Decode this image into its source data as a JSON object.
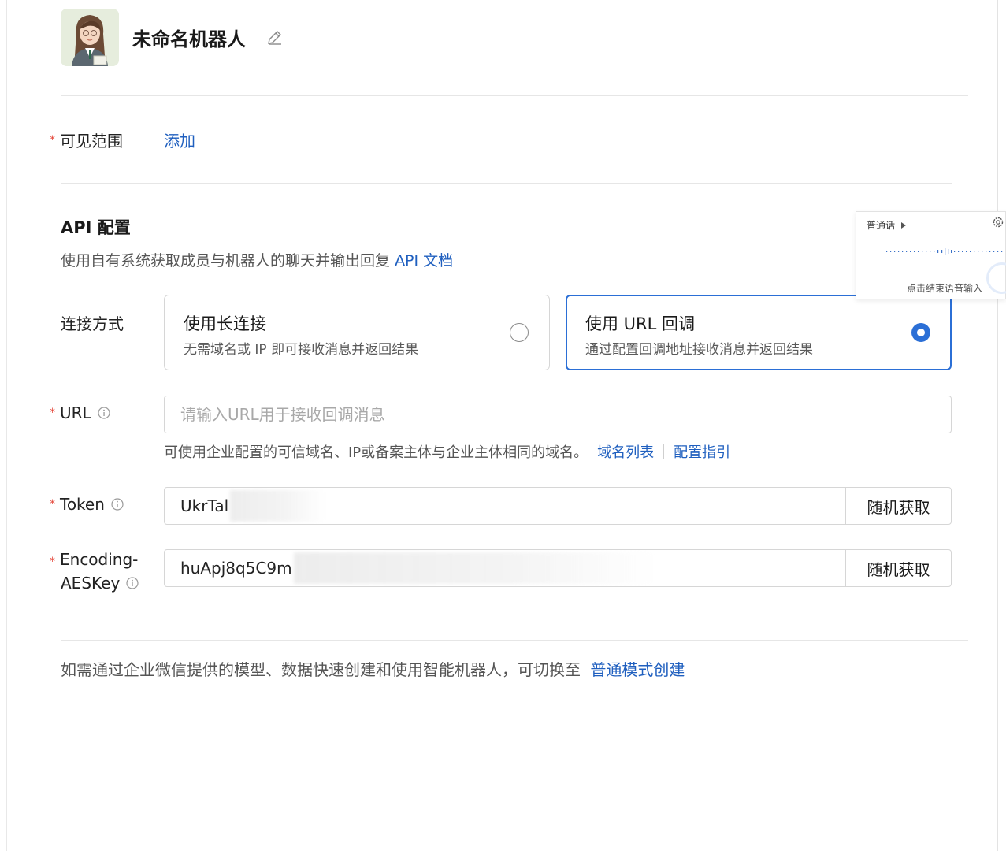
{
  "bot": {
    "name": "未命名机器人"
  },
  "visibility": {
    "label": "可见范围",
    "required_mark": "*",
    "add_link": "添加"
  },
  "api_section": {
    "title": "API 配置",
    "description": "使用自有系统获取成员与机器人的聊天并输出回复",
    "doc_link": "API 文档"
  },
  "connection": {
    "label": "连接方式",
    "options": [
      {
        "title": "使用长连接",
        "desc": "无需域名或 IP 即可接收消息并返回结果",
        "selected": false
      },
      {
        "title": "使用 URL 回调",
        "desc": "通过配置回调地址接收消息并返回结果",
        "selected": true
      }
    ]
  },
  "url_field": {
    "label": "URL",
    "required_mark": "*",
    "placeholder": "请输入URL用于接收回调消息",
    "value": "",
    "hint": "可使用企业配置的可信域名、IP或备案主体与企业主体相同的域名。",
    "hint_links": [
      "域名列表",
      "配置指引"
    ]
  },
  "token_field": {
    "label": "Token",
    "required_mark": "*",
    "value_visible": "UkrTal",
    "button": "随机获取"
  },
  "aeskey_field": {
    "label_line1": "Encoding-",
    "label_line2": "AESKey",
    "required_mark": "*",
    "value_visible": "huApj8q5C9m",
    "button": "随机获取"
  },
  "footer": {
    "text": "如需通过企业微信提供的模型、数据快速创建和使用智能机器人，可切换至",
    "link": "普通模式创建"
  },
  "voice_popup": {
    "language": "普通话",
    "hint": "点击结束语音输入"
  },
  "colors": {
    "accent": "#2b6fd6",
    "link": "#1f5fbf",
    "required": "#e5483b"
  }
}
